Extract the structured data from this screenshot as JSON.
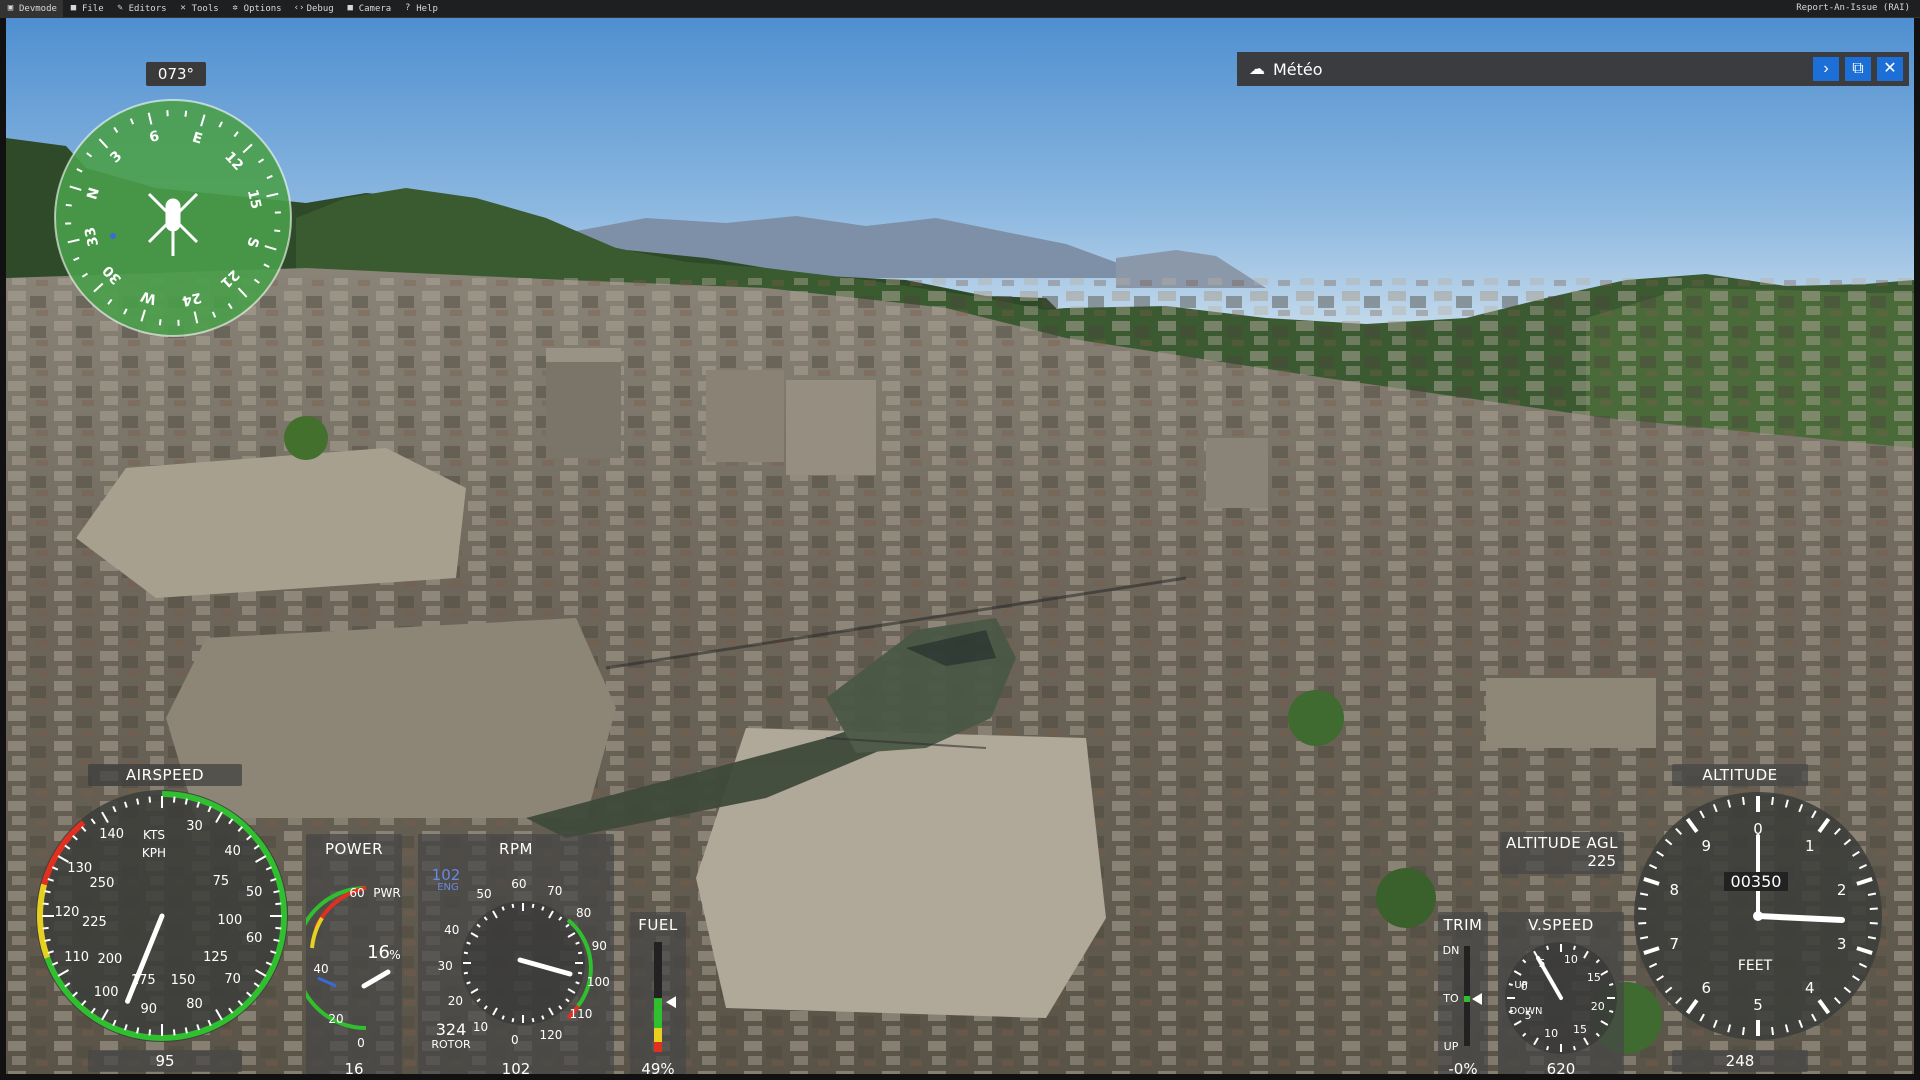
{
  "menubar": {
    "items": [
      {
        "label": "Devmode",
        "icon": "devmode-icon"
      },
      {
        "label": "File",
        "icon": "folder-icon"
      },
      {
        "label": "Editors",
        "icon": "pencil-icon"
      },
      {
        "label": "Tools",
        "icon": "tools-icon"
      },
      {
        "label": "Options",
        "icon": "gear-icon"
      },
      {
        "label": "Debug",
        "icon": "code-icon"
      },
      {
        "label": "Camera",
        "icon": "camera-icon"
      },
      {
        "label": "Help",
        "icon": "help-icon"
      }
    ],
    "report": "Report-An-Issue (RAI)"
  },
  "meteo": {
    "title": "Météo",
    "icon": "cloud-icon"
  },
  "compass": {
    "heading": "073°",
    "heading_deg": 73,
    "labels": [
      "N",
      "3",
      "6",
      "E",
      "12",
      "15",
      "S",
      "21",
      "24",
      "W",
      "30",
      "33"
    ]
  },
  "airspeed": {
    "title": "AIRSPEED",
    "kts_label": "KTS",
    "kph_label": "KPH",
    "value": "95",
    "kts_ticks": [
      "30",
      "40",
      "50",
      "60",
      "70",
      "80",
      "90",
      "100",
      "110",
      "120",
      "130",
      "140"
    ],
    "kph_ticks": [
      "75",
      "100",
      "125",
      "150",
      "175",
      "200",
      "225",
      "250"
    ]
  },
  "power": {
    "title": "POWER",
    "pwr_label": "PWR",
    "percent": "16",
    "percent_sign": "%",
    "value": "16",
    "ticks": [
      "60",
      "40",
      "20",
      "0"
    ]
  },
  "rpm": {
    "title": "RPM",
    "eng_value": "102",
    "eng_label": "ENG",
    "rotor_value": "324",
    "rotor_label": "ROTOR",
    "value": "102",
    "ticks": [
      "50",
      "60",
      "70",
      "80",
      "90",
      "100",
      "110",
      "120",
      "0",
      "10",
      "20",
      "30",
      "40"
    ]
  },
  "fuel": {
    "title": "FUEL",
    "value": "49%",
    "level": 0.49
  },
  "trim": {
    "title": "TRIM",
    "dn": "DN",
    "to": "TO",
    "up": "UP",
    "value": "-0%"
  },
  "vspeed": {
    "title": "V.SPEED",
    "up_label": "UP",
    "down_label": "DOWN",
    "value": "620",
    "ticks": [
      "10",
      "15",
      "20",
      "15",
      "10",
      "5",
      "0",
      "5"
    ]
  },
  "altitude_agl": {
    "title": "ALTITUDE AGL",
    "value": "225"
  },
  "altitude": {
    "title": "ALTITUDE",
    "feet_label": "FEET",
    "drum": "00350",
    "value": "248",
    "ticks": [
      "0",
      "1",
      "2",
      "3",
      "4",
      "5",
      "6",
      "7",
      "8",
      "9"
    ]
  },
  "colors": {
    "accent": "#1b6fd6",
    "compass": "#4a9e4a",
    "gauge_green": "#2fbf2f",
    "gauge_red": "#e03020",
    "gauge_yellow": "#e8d020"
  }
}
